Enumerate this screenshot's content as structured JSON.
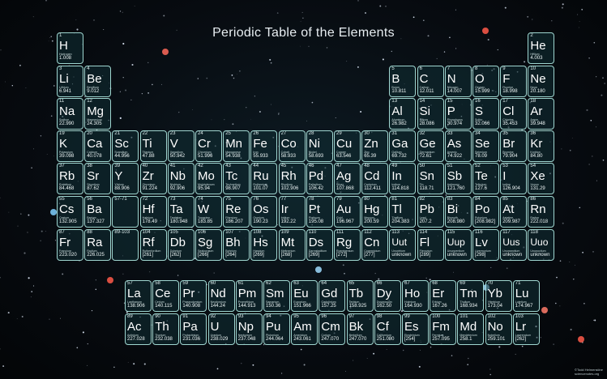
{
  "title": "Periodic Table of the Elements",
  "credit": {
    "line1": "©Todd Helmenstine",
    "line2": "sciencenotes.org"
  },
  "colors": {
    "cell_border": "#9fd6d0",
    "cell_fill": "#103034"
  },
  "placeholders": [
    {
      "id": "lanthanide-ref",
      "label": "57-71"
    },
    {
      "id": "actinide-ref",
      "label": "89-103"
    }
  ],
  "elements": [
    {
      "n": 1,
      "sym": "H",
      "name": "Hydrogen",
      "mass": "1.008"
    },
    {
      "n": 2,
      "sym": "He",
      "name": "Helium",
      "mass": "4.003"
    },
    {
      "n": 3,
      "sym": "Li",
      "name": "Lithium",
      "mass": "6.941"
    },
    {
      "n": 4,
      "sym": "Be",
      "name": "Beryllium",
      "mass": "9.012"
    },
    {
      "n": 5,
      "sym": "B",
      "name": "Boron",
      "mass": "10.811"
    },
    {
      "n": 6,
      "sym": "C",
      "name": "Carbon",
      "mass": "12.011"
    },
    {
      "n": 7,
      "sym": "N",
      "name": "Nitrogen",
      "mass": "14.007"
    },
    {
      "n": 8,
      "sym": "O",
      "name": "Oxygen",
      "mass": "15.999"
    },
    {
      "n": 9,
      "sym": "F",
      "name": "Fluorine",
      "mass": "18.998"
    },
    {
      "n": 10,
      "sym": "Ne",
      "name": "Neon",
      "mass": "20.180"
    },
    {
      "n": 11,
      "sym": "Na",
      "name": "Sodium",
      "mass": "22.990"
    },
    {
      "n": 12,
      "sym": "Mg",
      "name": "Magnesium",
      "mass": "24.305"
    },
    {
      "n": 13,
      "sym": "Al",
      "name": "Aluminum",
      "mass": "26.982"
    },
    {
      "n": 14,
      "sym": "Si",
      "name": "Silicon",
      "mass": "28.086"
    },
    {
      "n": 15,
      "sym": "P",
      "name": "Phosphorus",
      "mass": "30.974"
    },
    {
      "n": 16,
      "sym": "S",
      "name": "Sulfur",
      "mass": "32.066"
    },
    {
      "n": 17,
      "sym": "Cl",
      "name": "Chlorine",
      "mass": "35.453"
    },
    {
      "n": 18,
      "sym": "Ar",
      "name": "Argon",
      "mass": "39.948"
    },
    {
      "n": 19,
      "sym": "K",
      "name": "Potassium",
      "mass": "39.098"
    },
    {
      "n": 20,
      "sym": "Ca",
      "name": "Calcium",
      "mass": "40.078"
    },
    {
      "n": 21,
      "sym": "Sc",
      "name": "Scandium",
      "mass": "44.956"
    },
    {
      "n": 22,
      "sym": "Ti",
      "name": "Titanium",
      "mass": "47.88"
    },
    {
      "n": 23,
      "sym": "V",
      "name": "Vanadium",
      "mass": "50.942"
    },
    {
      "n": 24,
      "sym": "Cr",
      "name": "Chromium",
      "mass": "51.996"
    },
    {
      "n": 25,
      "sym": "Mn",
      "name": "Manganese",
      "mass": "54.938"
    },
    {
      "n": 26,
      "sym": "Fe",
      "name": "Iron",
      "mass": "55.933"
    },
    {
      "n": 27,
      "sym": "Co",
      "name": "Cobalt",
      "mass": "58.933"
    },
    {
      "n": 28,
      "sym": "Ni",
      "name": "Nickel",
      "mass": "58.693"
    },
    {
      "n": 29,
      "sym": "Cu",
      "name": "Copper",
      "mass": "63.546"
    },
    {
      "n": 30,
      "sym": "Zn",
      "name": "Zinc",
      "mass": "65.39"
    },
    {
      "n": 31,
      "sym": "Ga",
      "name": "Gallium",
      "mass": "69.732"
    },
    {
      "n": 32,
      "sym": "Ge",
      "name": "Germanium",
      "mass": "72.61"
    },
    {
      "n": 33,
      "sym": "As",
      "name": "Arsenic",
      "mass": "74.922"
    },
    {
      "n": 34,
      "sym": "Se",
      "name": "Selenium",
      "mass": "78.09"
    },
    {
      "n": 35,
      "sym": "Br",
      "name": "Bromine",
      "mass": "79.904"
    },
    {
      "n": 36,
      "sym": "Kr",
      "name": "Krypton",
      "mass": "84.80"
    },
    {
      "n": 37,
      "sym": "Rb",
      "name": "Rubidium",
      "mass": "84.468"
    },
    {
      "n": 38,
      "sym": "Sr",
      "name": "Strontium",
      "mass": "87.62"
    },
    {
      "n": 39,
      "sym": "Y",
      "name": "Yttrium",
      "mass": "88.906"
    },
    {
      "n": 40,
      "sym": "Zr",
      "name": "Zirconium",
      "mass": "91.224"
    },
    {
      "n": 41,
      "sym": "Nb",
      "name": "Niobium",
      "mass": "92.906"
    },
    {
      "n": 42,
      "sym": "Mo",
      "name": "Molybdenum",
      "mass": "95.94"
    },
    {
      "n": 43,
      "sym": "Tc",
      "name": "Technetium",
      "mass": "98.907"
    },
    {
      "n": 44,
      "sym": "Ru",
      "name": "Ruthenium",
      "mass": "101.07"
    },
    {
      "n": 45,
      "sym": "Rh",
      "name": "Rhodium",
      "mass": "102.906"
    },
    {
      "n": 46,
      "sym": "Pd",
      "name": "Palladium",
      "mass": "106.42"
    },
    {
      "n": 47,
      "sym": "Ag",
      "name": "Silver",
      "mass": "107.868"
    },
    {
      "n": 48,
      "sym": "Cd",
      "name": "Cadmium",
      "mass": "112.411"
    },
    {
      "n": 49,
      "sym": "In",
      "name": "Indium",
      "mass": "114.818"
    },
    {
      "n": 50,
      "sym": "Sn",
      "name": "Tin",
      "mass": "118.71"
    },
    {
      "n": 51,
      "sym": "Sb",
      "name": "Antimony",
      "mass": "121.760"
    },
    {
      "n": 52,
      "sym": "Te",
      "name": "Tellurium",
      "mass": "127.6"
    },
    {
      "n": 53,
      "sym": "I",
      "name": "Iodine",
      "mass": "126.904"
    },
    {
      "n": 54,
      "sym": "Xe",
      "name": "Xenon",
      "mass": "131.29"
    },
    {
      "n": 55,
      "sym": "Cs",
      "name": "Cesium",
      "mass": "132.905"
    },
    {
      "n": 56,
      "sym": "Ba",
      "name": "Barium",
      "mass": "137.327"
    },
    {
      "n": 72,
      "sym": "Hf",
      "name": "Hafnium",
      "mass": "178.49"
    },
    {
      "n": 73,
      "sym": "Ta",
      "name": "Tantalum",
      "mass": "180.948"
    },
    {
      "n": 74,
      "sym": "W",
      "name": "Tungsten",
      "mass": "183.85"
    },
    {
      "n": 75,
      "sym": "Re",
      "name": "Rhenium",
      "mass": "186.207"
    },
    {
      "n": 76,
      "sym": "Os",
      "name": "Osmium",
      "mass": "190.23"
    },
    {
      "n": 77,
      "sym": "Ir",
      "name": "Iridium",
      "mass": "192.22"
    },
    {
      "n": 78,
      "sym": "Pt",
      "name": "Platinum",
      "mass": "195.08"
    },
    {
      "n": 79,
      "sym": "Au",
      "name": "Gold",
      "mass": "196.967"
    },
    {
      "n": 80,
      "sym": "Hg",
      "name": "Mercury",
      "mass": "200.59"
    },
    {
      "n": 81,
      "sym": "Tl",
      "name": "Thallium",
      "mass": "204.383"
    },
    {
      "n": 82,
      "sym": "Pb",
      "name": "Lead",
      "mass": "207.2"
    },
    {
      "n": 83,
      "sym": "Bi",
      "name": "Bismuth",
      "mass": "208.980"
    },
    {
      "n": 84,
      "sym": "Po",
      "name": "Polonium",
      "mass": "[208.982]"
    },
    {
      "n": 85,
      "sym": "At",
      "name": "Astatine",
      "mass": "209.987"
    },
    {
      "n": 86,
      "sym": "Rn",
      "name": "Radon",
      "mass": "222.018"
    },
    {
      "n": 87,
      "sym": "Fr",
      "name": "Francium",
      "mass": "223.020"
    },
    {
      "n": 88,
      "sym": "Ra",
      "name": "Radium",
      "mass": "226.025"
    },
    {
      "n": 104,
      "sym": "Rf",
      "name": "Rutherfordium",
      "mass": "[261]"
    },
    {
      "n": 105,
      "sym": "Db",
      "name": "Dubnium",
      "mass": "[262]"
    },
    {
      "n": 106,
      "sym": "Sg",
      "name": "Seaborgium",
      "mass": "[266]"
    },
    {
      "n": 107,
      "sym": "Bh",
      "name": "Bohrium",
      "mass": "[264]"
    },
    {
      "n": 108,
      "sym": "Hs",
      "name": "Hassium",
      "mass": "[269]"
    },
    {
      "n": 109,
      "sym": "Mt",
      "name": "Meitnerium",
      "mass": "[268]"
    },
    {
      "n": 110,
      "sym": "Ds",
      "name": "Darmstadtium",
      "mass": "[269]"
    },
    {
      "n": 111,
      "sym": "Rg",
      "name": "Roentgenium",
      "mass": "[272]"
    },
    {
      "n": 112,
      "sym": "Cn",
      "name": "Copernicium",
      "mass": "[277]"
    },
    {
      "n": 113,
      "sym": "Uut",
      "name": "Ununtrium",
      "mass": "unknown"
    },
    {
      "n": 114,
      "sym": "Fl",
      "name": "Flerovium",
      "mass": "[289]"
    },
    {
      "n": 115,
      "sym": "Uup",
      "name": "Ununpentium",
      "mass": "unknown"
    },
    {
      "n": 116,
      "sym": "Lv",
      "name": "Livermorium",
      "mass": "[298]"
    },
    {
      "n": 117,
      "sym": "Uus",
      "name": "Ununseptium",
      "mass": "unknown"
    },
    {
      "n": 118,
      "sym": "Uuo",
      "name": "Ununoctium",
      "mass": "unknown"
    },
    {
      "n": 57,
      "sym": "La",
      "name": "Lanthanum",
      "mass": "138.906"
    },
    {
      "n": 58,
      "sym": "Ce",
      "name": "Cerium",
      "mass": "140.115"
    },
    {
      "n": 59,
      "sym": "Pr",
      "name": "Praseodymium",
      "mass": "140.908"
    },
    {
      "n": 60,
      "sym": "Nd",
      "name": "Neodymium",
      "mass": "144.24"
    },
    {
      "n": 61,
      "sym": "Pm",
      "name": "Promethium",
      "mass": "144.913"
    },
    {
      "n": 62,
      "sym": "Sm",
      "name": "Samarium",
      "mass": "150.36"
    },
    {
      "n": 63,
      "sym": "Eu",
      "name": "Europium",
      "mass": "151.966"
    },
    {
      "n": 64,
      "sym": "Gd",
      "name": "Gadolinium",
      "mass": "157.25"
    },
    {
      "n": 65,
      "sym": "Tb",
      "name": "Terbium",
      "mass": "158.925"
    },
    {
      "n": 66,
      "sym": "Dy",
      "name": "Dysprosium",
      "mass": "162.50"
    },
    {
      "n": 67,
      "sym": "Ho",
      "name": "Holmium",
      "mass": "164.930"
    },
    {
      "n": 68,
      "sym": "Er",
      "name": "Erbium",
      "mass": "167.26"
    },
    {
      "n": 69,
      "sym": "Tm",
      "name": "Thulium",
      "mass": "168.934"
    },
    {
      "n": 70,
      "sym": "Yb",
      "name": "Ytterbium",
      "mass": "173.04"
    },
    {
      "n": 71,
      "sym": "Lu",
      "name": "Lutetium",
      "mass": "174.967"
    },
    {
      "n": 89,
      "sym": "Ac",
      "name": "Actinium",
      "mass": "227.028"
    },
    {
      "n": 90,
      "sym": "Th",
      "name": "Thorium",
      "mass": "232.038"
    },
    {
      "n": 91,
      "sym": "Pa",
      "name": "Protactinium",
      "mass": "231.036"
    },
    {
      "n": 92,
      "sym": "U",
      "name": "Uranium",
      "mass": "238.029"
    },
    {
      "n": 93,
      "sym": "Np",
      "name": "Neptunium",
      "mass": "237.048"
    },
    {
      "n": 94,
      "sym": "Pu",
      "name": "Plutonium",
      "mass": "244.064"
    },
    {
      "n": 95,
      "sym": "Am",
      "name": "Americium",
      "mass": "243.061"
    },
    {
      "n": 96,
      "sym": "Cm",
      "name": "Curium",
      "mass": "247.070"
    },
    {
      "n": 97,
      "sym": "Bk",
      "name": "Berkelium",
      "mass": "247.070"
    },
    {
      "n": 98,
      "sym": "Cf",
      "name": "Californium",
      "mass": "251.080"
    },
    {
      "n": 99,
      "sym": "Es",
      "name": "Einsteinium",
      "mass": "[254]"
    },
    {
      "n": 100,
      "sym": "Fm",
      "name": "Fermium",
      "mass": "257.095"
    },
    {
      "n": 101,
      "sym": "Md",
      "name": "Mendelevium",
      "mass": "258.1"
    },
    {
      "n": 102,
      "sym": "No",
      "name": "Nobelium",
      "mass": "259.101"
    },
    {
      "n": 103,
      "sym": "Lr",
      "name": "Lawrencium",
      "mass": "[262]"
    }
  ]
}
